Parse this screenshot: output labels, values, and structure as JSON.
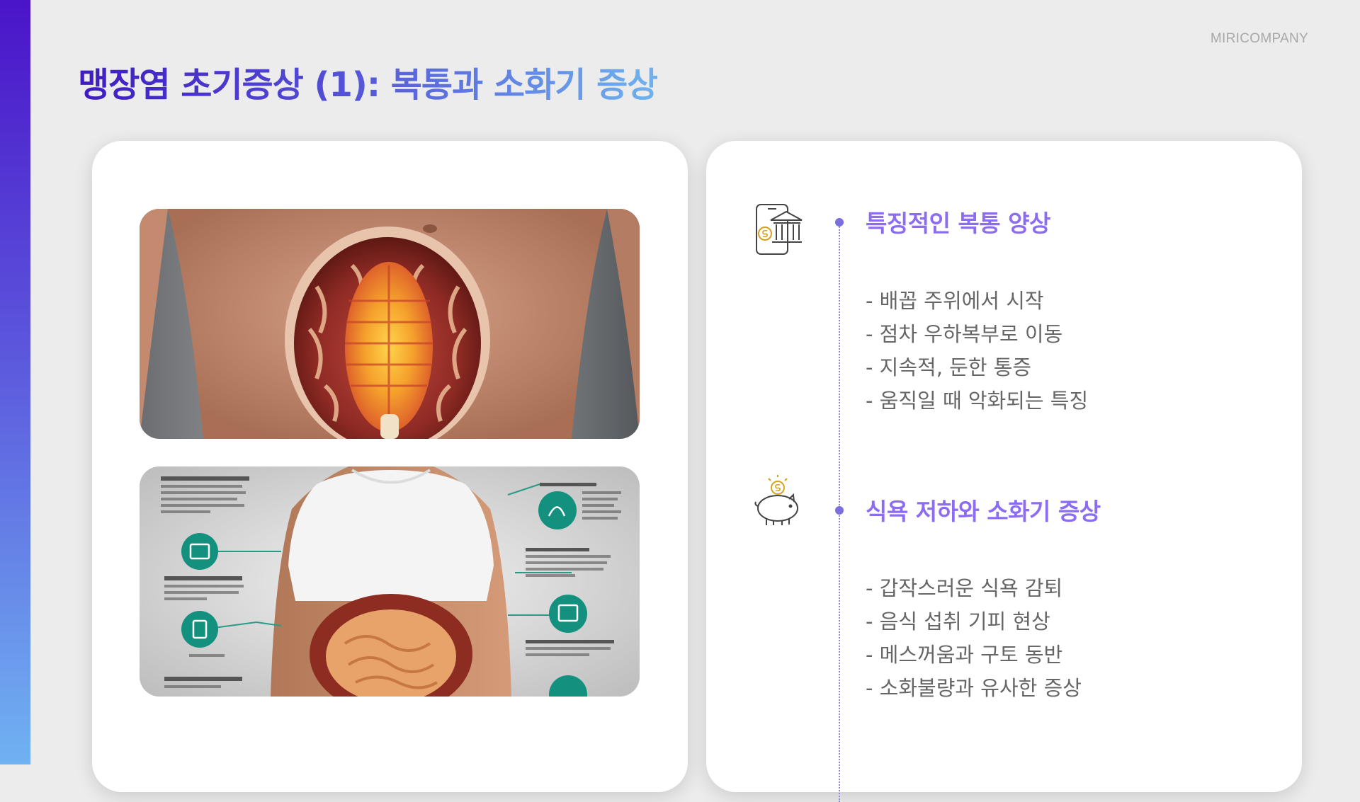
{
  "brand": "MIRICOMPANY",
  "title": "맹장염 초기증상 (1): 복통과 소화기 증상",
  "images": [
    {
      "name": "abdomen-cross-section-image"
    },
    {
      "name": "digestive-infographic-image"
    }
  ],
  "sections": [
    {
      "icon": "mobile-bank-icon",
      "title": "특징적인 복통 양상",
      "items": [
        "- 배꼽 주위에서 시작",
        "- 점차 우하복부로 이동",
        "- 지속적, 둔한 통증",
        "- 움직일 때 악화되는 특징"
      ]
    },
    {
      "icon": "piggy-bank-icon",
      "title": "식욕 저하와 소화기 증상",
      "items": [
        "- 갑작스러운 식욕 감퇴",
        "- 음식 섭취 기피 현상",
        "- 메스꺼움과 구토 동반",
        "- 소화불량과 유사한 증상"
      ]
    }
  ],
  "colors": {
    "accent_dark": "#4a14c8",
    "accent_light": "#70b2f2",
    "section_title": "#8c6cf0",
    "timeline": "#8d8cd9"
  }
}
